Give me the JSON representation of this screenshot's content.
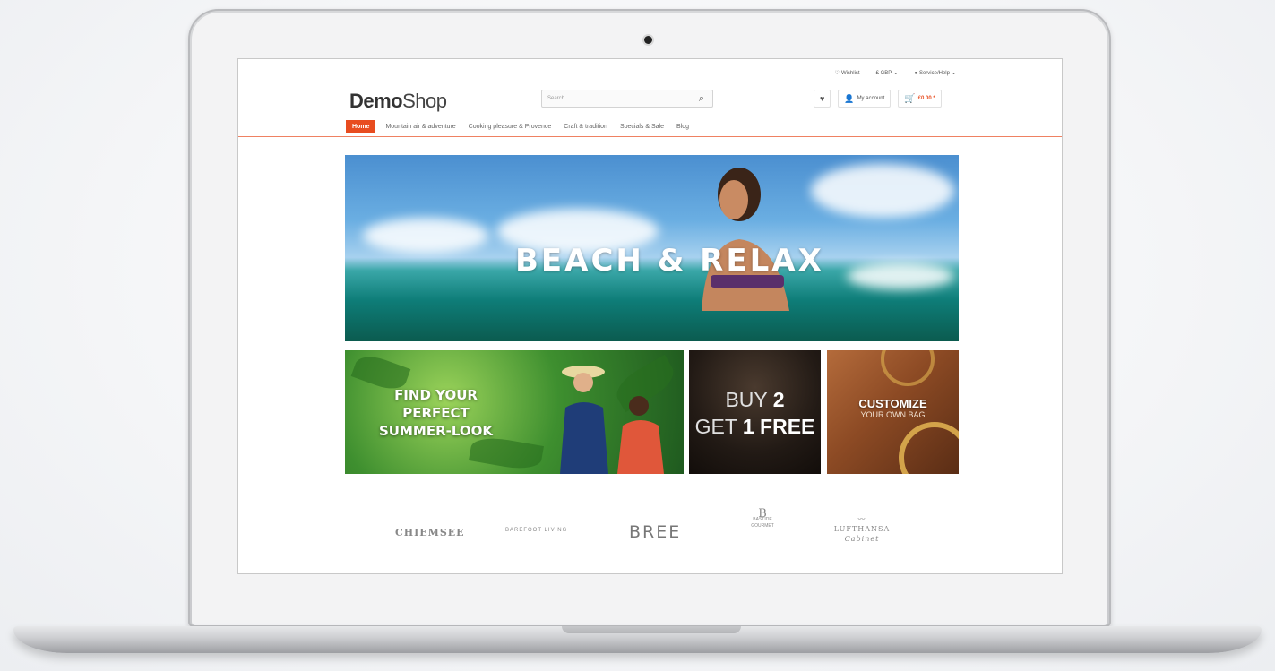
{
  "topbar": {
    "wishlist": "Wishlist",
    "currency": "£ GBP",
    "service": "Service/Help"
  },
  "logo": {
    "bold": "Demo",
    "thin": "Shop"
  },
  "search": {
    "placeholder": "Search..."
  },
  "account": {
    "my_account": "My account",
    "cart_total": "£0.00 *"
  },
  "nav": {
    "items": [
      {
        "label": "Home",
        "active": true
      },
      {
        "label": "Mountain air & adventure"
      },
      {
        "label": "Cooking pleasure & Provence"
      },
      {
        "label": "Craft & tradition"
      },
      {
        "label": "Specials & Sale"
      },
      {
        "label": "Blog"
      }
    ]
  },
  "hero": {
    "title": "BEACH & RELAX"
  },
  "teasers": {
    "summer": {
      "line1": "FIND YOUR",
      "line2": "PERFECT",
      "line3": "SUMMER-LOOK"
    },
    "buy": {
      "thin1": "BUY ",
      "bold1": "2",
      "thin2": "GET ",
      "bold2": "1 FREE"
    },
    "customize": {
      "title": "CUSTOMIZE",
      "sub": "YOUR OWN BAG"
    }
  },
  "brands": {
    "chiemsee": "CHIEMSEE",
    "barefoot": "BAREFOOT LIVING",
    "bree": "BREE",
    "bastide_mono": "B",
    "bastide": "BASTIDE GOURMET",
    "lufthansa": "LUFTHANSA",
    "lufthansa_sub": "Cabinet"
  },
  "colors": {
    "accent": "#e84c1f"
  }
}
